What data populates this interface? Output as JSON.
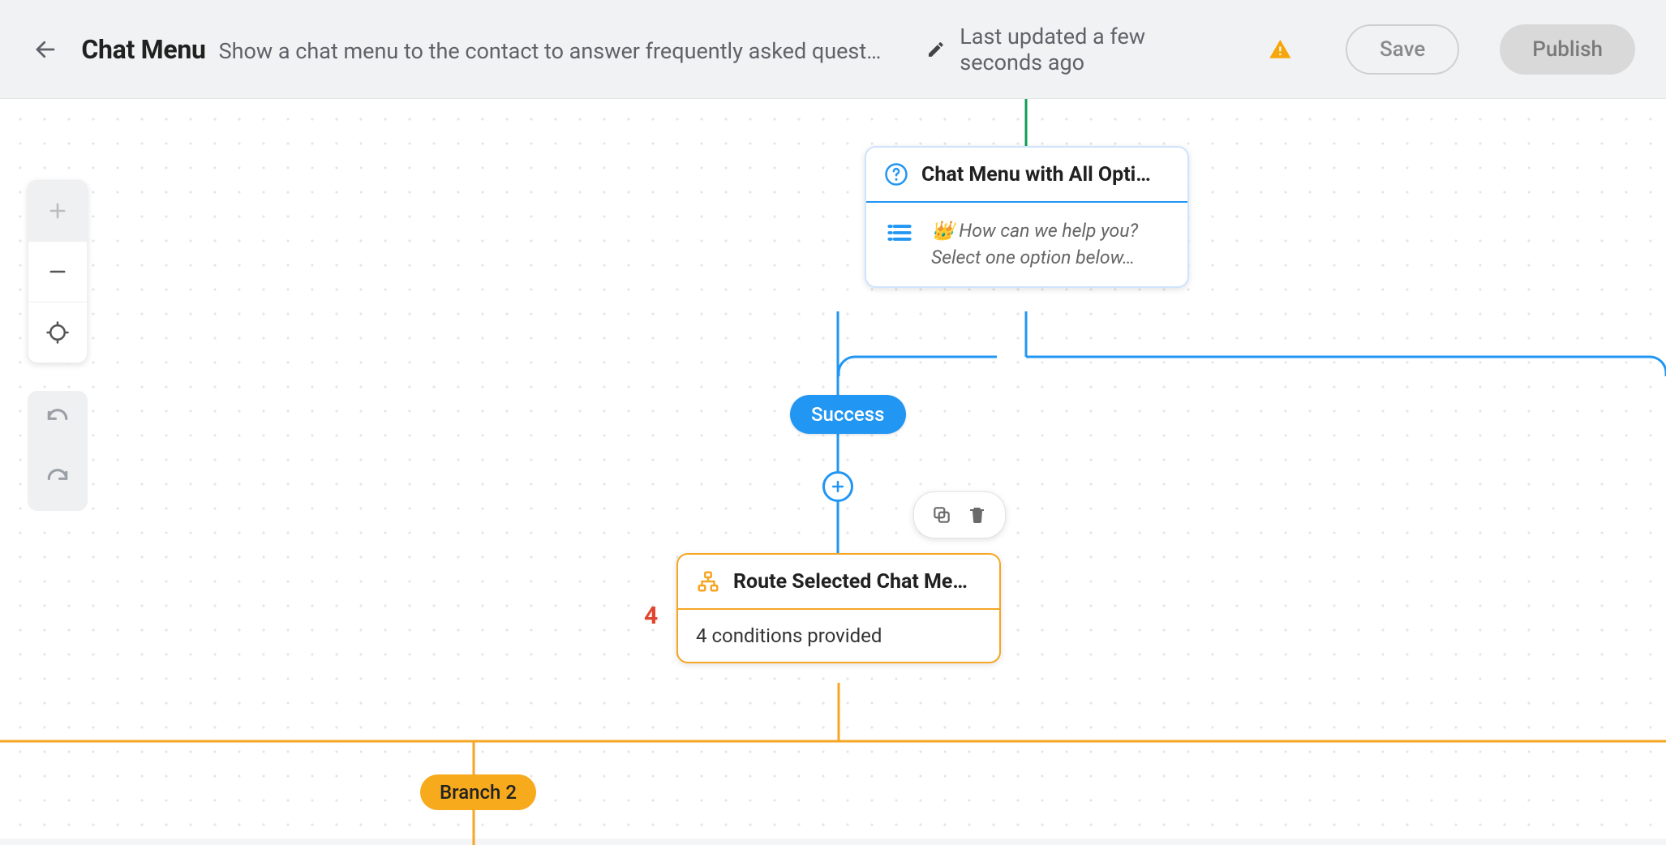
{
  "header": {
    "title": "Chat Menu",
    "subtitle": "Show a chat menu to the contact to answer frequently asked questio…",
    "last_updated": "Last updated a few seconds ago",
    "save_label": "Save",
    "publish_label": "Publish"
  },
  "canvas": {
    "chat_menu_node": {
      "title": "Chat Menu with All Opti…",
      "line1": "👑 How can we help you?",
      "line2": "Select one option below…"
    },
    "success_pill": "Success",
    "route_node": {
      "title": "Route Selected Chat Me…",
      "body": "4 conditions provided",
      "badge": "4"
    },
    "branch_pill": "Branch 2"
  }
}
